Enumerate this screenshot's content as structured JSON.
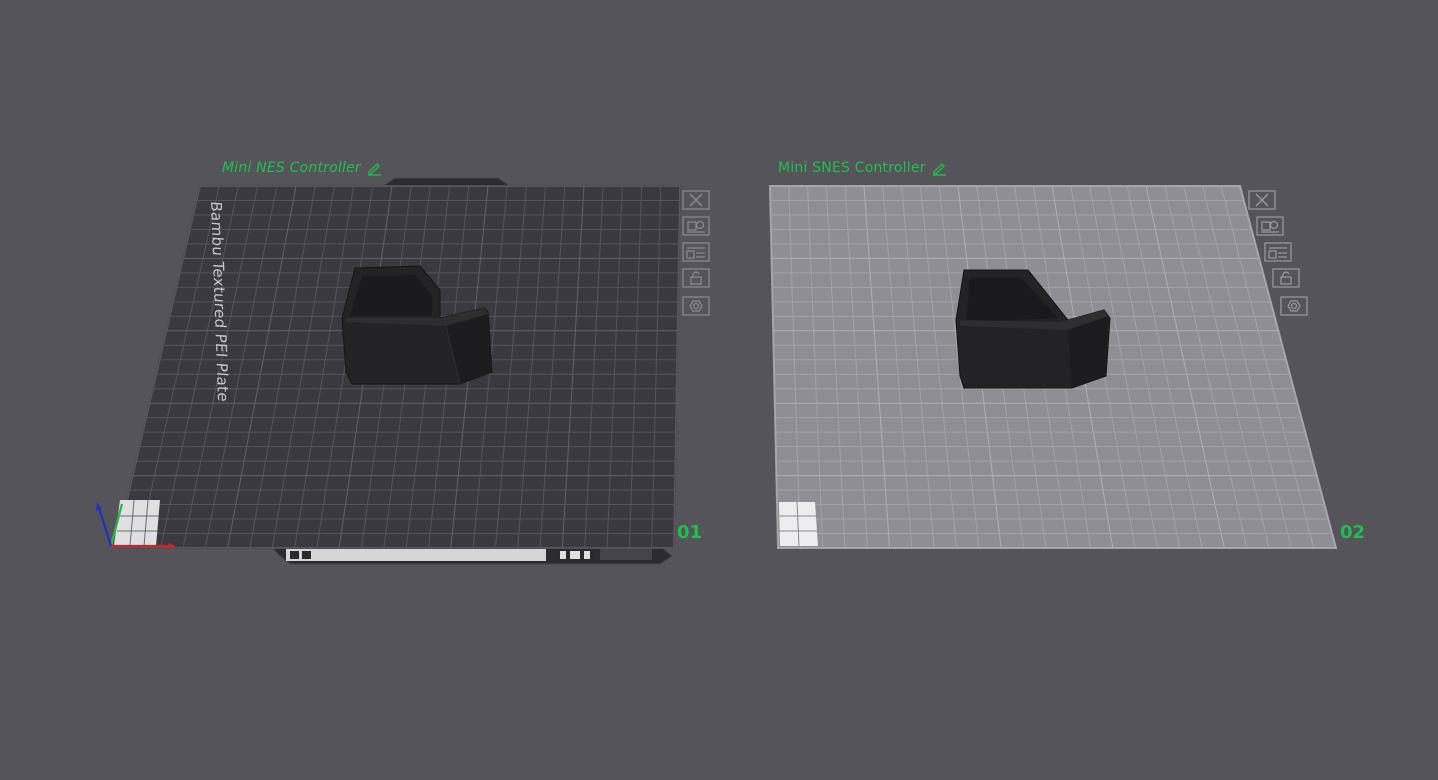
{
  "plates": [
    {
      "name": "Mini NES Controller",
      "number": "01",
      "plate_type_label": "Bambu Textured PEI Plate",
      "active": true,
      "icons": [
        "close-icon",
        "arrange-icon",
        "orient-icon",
        "lock-icon",
        "settings-icon"
      ]
    },
    {
      "name": "Mini SNES Controller",
      "number": "02",
      "active": false,
      "icons": [
        "close-icon",
        "arrange-icon",
        "orient-icon",
        "lock-icon",
        "settings-icon"
      ]
    }
  ],
  "colors": {
    "background": "#55545a",
    "accent": "#1ec04a",
    "active_plate": "#3a393f",
    "inactive_plate": "#8f8e94",
    "model": "#232325"
  },
  "axes": {
    "x_color": "#d0202a",
    "y_color": "#25b84a",
    "z_color": "#2030c0"
  }
}
